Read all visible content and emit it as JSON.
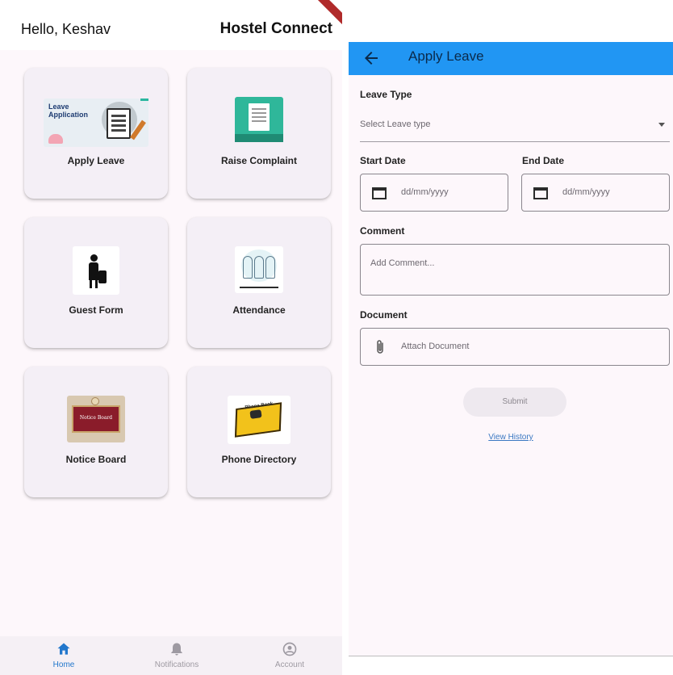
{
  "left_screen": {
    "greeting": "Hello, Keshav",
    "app_title": "Hostel Connect",
    "cards": {
      "apply_leave": {
        "label": "Apply Leave",
        "thumb_text": "Leave\nApplication"
      },
      "raise_complaint": {
        "label": "Raise Complaint"
      },
      "guest_form": {
        "label": "Guest Form"
      },
      "attendance": {
        "label": "Attendance"
      },
      "notice_board": {
        "label": "Notice Board",
        "thumb_text": "Notice Board"
      },
      "phone_directory": {
        "label": "Phone Directory",
        "thumb_text": "Phone Book"
      }
    },
    "bottom_nav": {
      "items": [
        {
          "label": "Home",
          "icon": "home-icon",
          "active": true
        },
        {
          "label": "Notifications",
          "icon": "bell-icon",
          "active": false
        },
        {
          "label": "Account",
          "icon": "account-circle-icon",
          "active": false
        }
      ]
    }
  },
  "right_screen": {
    "appbar": {
      "title": "Apply Leave",
      "back_icon": "arrow-left-icon"
    },
    "form": {
      "leave_type_label": "Leave Type",
      "leave_type_placeholder": "Select Leave type",
      "start_date_label": "Start Date",
      "start_date_placeholder": "dd/mm/yyyy",
      "end_date_label": "End Date",
      "end_date_placeholder": "dd/mm/yyyy",
      "comment_label": "Comment",
      "comment_placeholder": "Add Comment...",
      "document_label": "Document",
      "document_placeholder": "Attach Document",
      "submit_label": "Submit",
      "history_link": "View History"
    }
  },
  "colors": {
    "primary_blue": "#2196f3",
    "background": "#fdf7fb",
    "card": "#f4eff6",
    "nav_active": "#2277cc"
  }
}
